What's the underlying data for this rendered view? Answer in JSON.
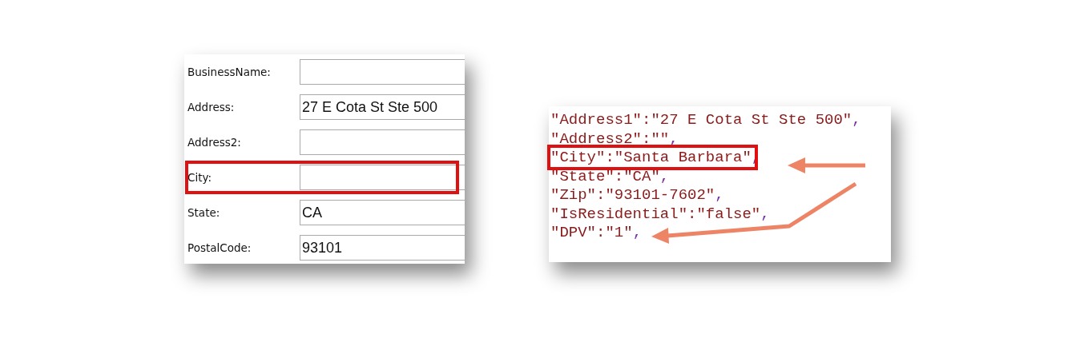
{
  "form": {
    "fields": [
      {
        "label": "BusinessName:",
        "highlighted": false
      },
      {
        "label": "Address:",
        "value": "27 E Cota St Ste 500",
        "highlighted": false
      },
      {
        "label": "Address2:",
        "highlighted": false
      },
      {
        "label": "City:",
        "highlighted": true
      },
      {
        "label": "State:",
        "value": "CA",
        "highlighted": false
      },
      {
        "label": "PostalCode:",
        "value": "93101",
        "highlighted": false
      }
    ]
  },
  "code": {
    "lines": [
      {
        "text": "\"Address1\":\"27 E Cota St Ste 500\"",
        "punct": ",",
        "highlighted": false
      },
      {
        "text": "\"Address2\":\"\"",
        "punct": ",",
        "highlighted": false
      },
      {
        "text": "\"City\":\"Santa Barbara\"",
        "punct": ",",
        "highlighted": true
      },
      {
        "text": "\"State\":\"CA\"",
        "punct": ",",
        "highlighted": false
      },
      {
        "text": "\"Zip\":\"93101-7602\"",
        "punct": ",",
        "highlighted": false
      },
      {
        "text": "\"IsResidential\":\"false\"",
        "punct": ",",
        "highlighted": false
      },
      {
        "text": "\"DPV\":\"1\"",
        "punct": ",",
        "highlighted": false
      }
    ]
  }
}
